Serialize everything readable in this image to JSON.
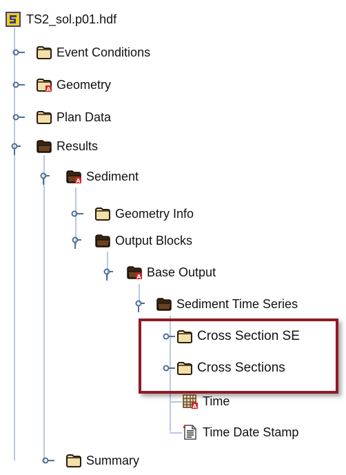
{
  "tree": {
    "root": {
      "label": "TS2_sol.p01.hdf",
      "icon": "hdf-file-icon"
    },
    "items": [
      {
        "label": "Event Conditions",
        "icon": "folder-closed-icon"
      },
      {
        "label": "Geometry",
        "icon": "folder-attribute-icon"
      },
      {
        "label": "Plan Data",
        "icon": "folder-closed-icon"
      },
      {
        "label": "Results",
        "icon": "folder-open-icon"
      },
      {
        "label": "Sediment",
        "icon": "folder-open-attribute-icon"
      },
      {
        "label": "Geometry Info",
        "icon": "folder-closed-icon"
      },
      {
        "label": "Output Blocks",
        "icon": "folder-open-icon"
      },
      {
        "label": "Base Output",
        "icon": "folder-open-attribute-icon"
      },
      {
        "label": "Sediment Time Series",
        "icon": "folder-open-icon"
      },
      {
        "label": "Cross Section SE",
        "icon": "folder-closed-icon"
      },
      {
        "label": "Cross Sections",
        "icon": "folder-closed-icon"
      },
      {
        "label": "Time",
        "icon": "dataset-table-icon"
      },
      {
        "label": "Time Date Stamp",
        "icon": "text-dataset-icon"
      },
      {
        "label": "Summary",
        "icon": "folder-closed-icon"
      }
    ]
  },
  "colors": {
    "tree_line": "#b8c8df",
    "highlight_border": "#8e1b26",
    "folder_fill": "#f3dfa8",
    "folder_dark": "#3a2410"
  }
}
